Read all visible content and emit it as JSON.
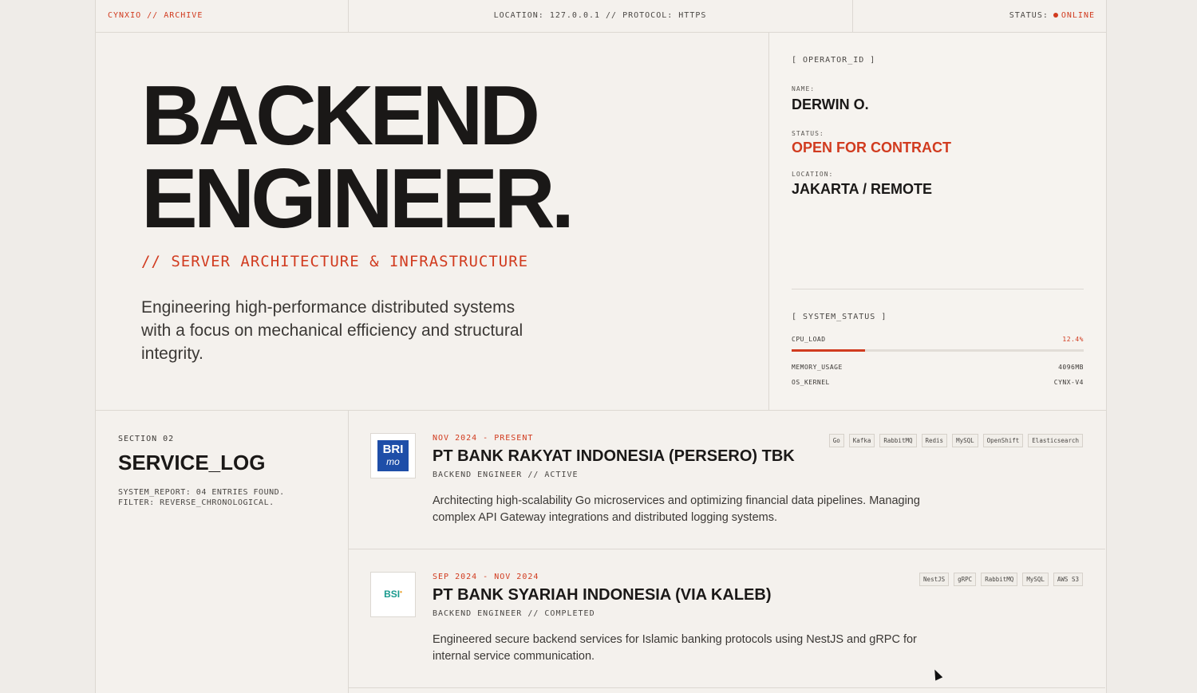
{
  "topbar": {
    "brand": "CYNXIO // ARCHIVE",
    "location": "LOCATION: 127.0.0.1 // PROTOCOL: HTTPS",
    "status_label": "STATUS:",
    "status_value": "ONLINE"
  },
  "hero": {
    "title_line1": "BACKEND",
    "title_line2": "ENGINEER.",
    "subtitle": "// SERVER ARCHITECTURE & INFRASTRUCTURE",
    "description": "Engineering high-performance distributed systems with a focus on mechanical efficiency and structural integrity."
  },
  "operator": {
    "heading": "[ OPERATOR_ID ]",
    "name_label": "NAME:",
    "name": "DERWIN O.",
    "status_label": "STATUS:",
    "status": "OPEN FOR CONTRACT",
    "location_label": "LOCATION:",
    "location": "JAKARTA / REMOTE"
  },
  "system": {
    "heading": "[ SYSTEM_STATUS ]",
    "cpu_label": "CPU_LOAD",
    "cpu_value": "12.4%",
    "cpu_fraction": 0.25,
    "memory_label": "MEMORY_USAGE",
    "memory_value": "4096MB",
    "kernel_label": "OS_KERNEL",
    "kernel_value": "CYNX-V4"
  },
  "service_log": {
    "section": "SECTION 02",
    "title": "SERVICE_LOG",
    "report_line1": "SYSTEM_REPORT: 04 ENTRIES FOUND.",
    "report_line2": "FILTER: REVERSE_CHRONOLOGICAL."
  },
  "entries": [
    {
      "date": "NOV 2024 - PRESENT",
      "company": "PT BANK RAKYAT INDONESIA (PERSERO) TBK",
      "role": "BACKEND ENGINEER // ACTIVE",
      "description": "Architecting high-scalability Go microservices and optimizing financial data pipelines. Managing complex API Gateway integrations and distributed logging systems.",
      "logo_text_top": "BRI",
      "logo_text_bottom": "mo",
      "tags": [
        "Go",
        "Kafka",
        "RabbitMQ",
        "Redis",
        "MySQL",
        "OpenShift",
        "Elasticsearch"
      ]
    },
    {
      "date": "SEP 2024 - NOV 2024",
      "company": "PT BANK SYARIAH INDONESIA (VIA KALEB)",
      "role": "BACKEND ENGINEER // COMPLETED",
      "description": "Engineered secure backend services for Islamic banking protocols using NestJS and gRPC for internal service communication.",
      "logo_text_top": "BSI",
      "tags": [
        "NestJS",
        "gRPC",
        "RabbitMQ",
        "MySQL",
        "AWS S3"
      ]
    }
  ],
  "colors": {
    "accent": "#d13b1f",
    "bri_blue": "#1e4ea8",
    "bsi_teal": "#1a9a8e"
  }
}
